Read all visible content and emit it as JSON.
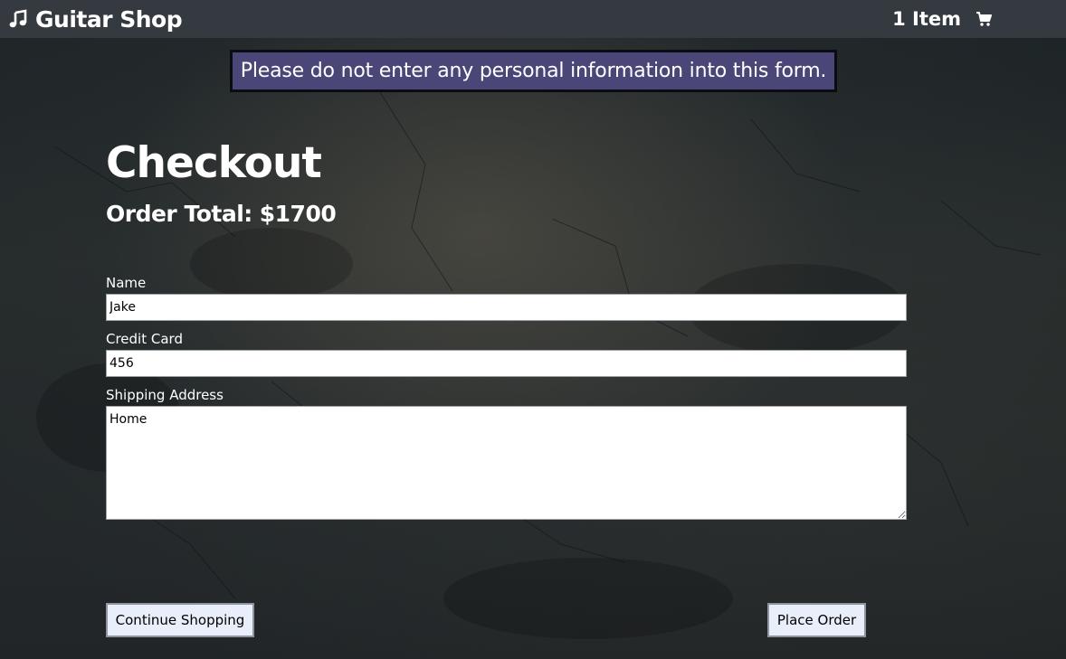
{
  "navbar": {
    "brand_icon": "music-note-icon",
    "brand_text": "Guitar Shop",
    "cart_count": "1 Item",
    "cart_icon": "shopping-cart-icon",
    "background_color": "#343a40"
  },
  "banner": {
    "text": "Please do not enter any personal information into this form.",
    "background_color": "#4a4678"
  },
  "checkout": {
    "title": "Checkout",
    "order_total_label": "Order Total:",
    "order_total_value": "$1700"
  },
  "form": {
    "name_label": "Name",
    "name_value": "Jake",
    "credit_card_label": "Credit Card",
    "credit_card_value": "456",
    "shipping_address_label": "Shipping Address",
    "shipping_address_value": "Home"
  },
  "buttons": {
    "continue_shopping": "Continue Shopping",
    "place_order": "Place Order",
    "background_color": "#e8eefa"
  }
}
